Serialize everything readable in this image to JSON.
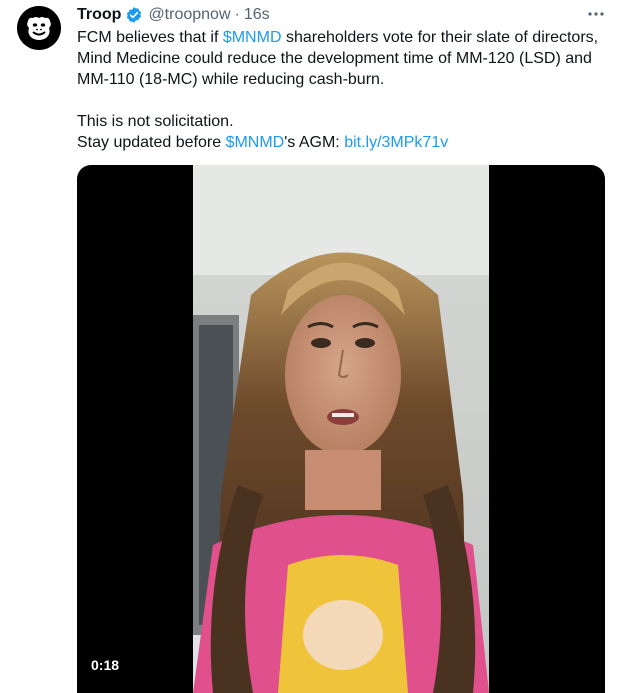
{
  "author": {
    "name": "Troop",
    "handle": "@troopnow",
    "separator": "·",
    "time": "16s",
    "avatar_icon": "gorilla-logo-icon",
    "verified_icon": "verified-badge-icon"
  },
  "more_icon": "more-options-icon",
  "tweet": {
    "line1_pre": "FCM believes that if ",
    "line1_ticker": "$MNMD",
    "line1_post": " shareholders vote for their slate of directors, Mind Medicine could reduce the development time of MM-120 (LSD) and MM-110 (18-MC) while reducing cash-burn.",
    "line2": "This is not solicitation.",
    "line3_pre": "Stay updated before ",
    "line3_ticker": "$MNMD",
    "line3_mid": "'s AGM: ",
    "line3_link": "bit.ly/3MPk71v"
  },
  "video": {
    "duration": "0:18"
  },
  "colors": {
    "link": "#1d9bf0",
    "verified": "#1d9bf0",
    "secondary_text": "#536471",
    "video_background": "#000000"
  }
}
